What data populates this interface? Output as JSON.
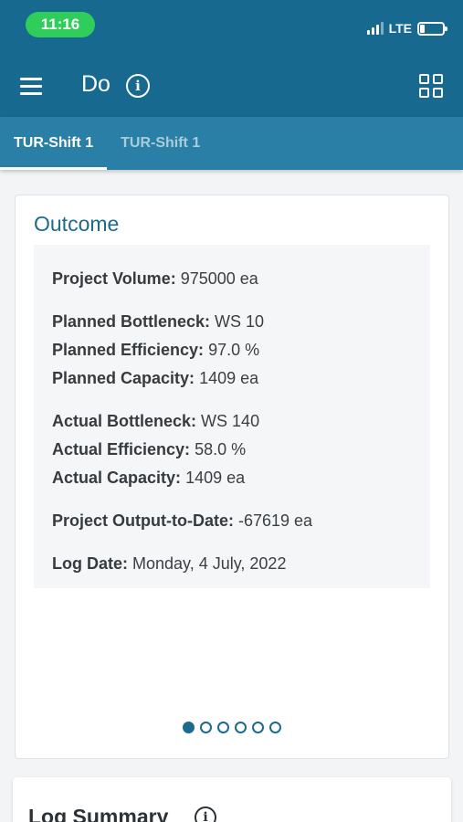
{
  "status_bar": {
    "time": "11:16",
    "network": "LTE",
    "battery_level": 0.15
  },
  "app_bar": {
    "menu_icon": "hamburger-menu-icon",
    "title": "Do",
    "info_icon": "info-circle-icon",
    "info_glyph": "i",
    "grid_icon": "grid-view-icon"
  },
  "tabs": [
    {
      "label": "TUR-Shift 1",
      "active": true
    },
    {
      "label": "TUR-Shift 1",
      "active": false
    }
  ],
  "outcome": {
    "title": "Outcome",
    "project_volume": {
      "label": "Project Volume:",
      "value": "975000 ea"
    },
    "planned_bottleneck": {
      "label": "Planned Bottleneck:",
      "value": "WS 10"
    },
    "planned_efficiency": {
      "label": "Planned Efficiency:",
      "value": "97.0 %"
    },
    "planned_capacity": {
      "label": "Planned Capacity:",
      "value": "1409 ea"
    },
    "actual_bottleneck": {
      "label": "Actual Bottleneck:",
      "value": "WS 140"
    },
    "actual_efficiency": {
      "label": "Actual Efficiency:",
      "value": "58.0 %"
    },
    "actual_capacity": {
      "label": "Actual Capacity:",
      "value": "1409 ea"
    },
    "project_output": {
      "label": "Project Output-to-Date:",
      "value": "-67619 ea"
    },
    "log_date": {
      "label": "Log Date:",
      "value": "Monday, 4 July, 2022"
    }
  },
  "pager": {
    "count": 6,
    "active_index": 0
  },
  "log_summary": {
    "title": "Log Summary",
    "info_glyph": "i"
  },
  "colors": {
    "app_bar": "#17698f",
    "tab_bar": "#2a7fa6",
    "accent": "#1d6a8c",
    "status_pill": "#2fcd5a"
  }
}
